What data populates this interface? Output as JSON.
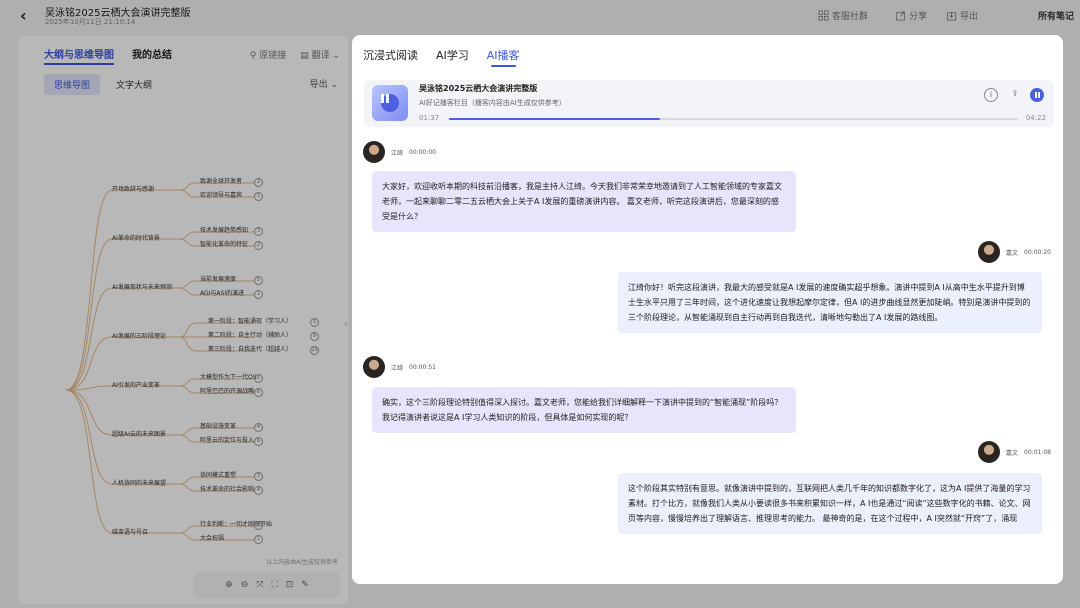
{
  "topbar": {
    "title": "吴泳铭2025云栖大会演讲完整版",
    "time": "2025年10月11日 21:10:14",
    "community": "客服社群",
    "share": "分享",
    "export": "导出",
    "all_notes": "所有笔记"
  },
  "left": {
    "tab_outline": "大纲与思维导图",
    "tab_summary": "我的总结",
    "source_link": "原链接",
    "translate": "翻译",
    "seg_mindmap": "思维导图",
    "seg_outline": "文字大纲",
    "export": "导出",
    "note": "以上内容由AI生成仅供参考",
    "mindmap": [
      {
        "label": "开场致辞与感谢",
        "children": [
          [
            "致谢全球开发者",
            "2"
          ],
          [
            "欢迎领导与嘉宾",
            "1"
          ]
        ]
      },
      {
        "label": "AI革命的时代背景",
        "children": [
          [
            "技术发展趋势感知",
            "3"
          ],
          [
            "智能化革命的特征",
            "2"
          ]
        ]
      },
      {
        "label": "AI发展现状与未来预测",
        "children": [
          [
            "当前发展速度",
            "5"
          ],
          [
            "AGI与ASI的演进",
            "1"
          ]
        ]
      },
      {
        "label": "AI发展的三阶段理论",
        "children": [
          [
            "第一阶段：智能涌现（学习人）",
            "5"
          ],
          [
            "第二阶段：自主行动（辅助人）",
            "9"
          ],
          [
            "第三阶段：自我迭代（超越人）",
            "10"
          ]
        ]
      },
      {
        "label": "AI引发的产业变革",
        "children": [
          [
            "大模型作为下一代OS",
            "5"
          ],
          [
            "阿里巴巴的开源战略",
            "6"
          ]
        ]
      },
      {
        "label": "超级AI云的未来图景",
        "children": [
          [
            "基础设施变革",
            "4"
          ],
          [
            "阿里云的定位与投入",
            "6"
          ]
        ]
      },
      {
        "label": "人机协同的未来展望",
        "children": [
          [
            "协同模式重塑",
            "3"
          ],
          [
            "技术革命的社会影响",
            "4"
          ]
        ]
      },
      {
        "label": "结束语与号召",
        "children": [
          [
            "行业判断：一切才刚刚开始",
            "3"
          ],
          [
            "大会祝福",
            "1"
          ]
        ]
      }
    ]
  },
  "modal": {
    "tabs": [
      "沉浸式阅读",
      "AI学习",
      "AI播客"
    ],
    "active_tab": 2,
    "player": {
      "title": "吴泳铭2025云栖大会演讲完整版",
      "subtitle": "AI好记播客栏目（播客内容由AI生成仅供参考）",
      "current": "01:37",
      "total": "04:22",
      "progress": 0.37
    },
    "messages": [
      {
        "speaker": "江绮",
        "time": "00:00:00",
        "side": "left",
        "text": "大家好，欢迎收听本期的科技前沿播客，我是主持人江绮。今天我们非常荣幸地邀请到了人工智能领域的专家嘉文老师，一起来聊聊二零二五云栖大会上关于A I发展的重磅演讲内容。 嘉文老师，听完这段演讲后，您最深刻的感受是什么？"
      },
      {
        "speaker": "嘉文",
        "time": "00:00:20",
        "side": "right",
        "text": "江绮你好！听完这段演讲，我最大的感受就是A I发展的速度确实超乎想象。演讲中提到A I从高中生水平提升到博士生水平只用了三年时间，这个进化速度让我想起摩尔定律，但A I的进步曲线显然更加陡峭。特别是演讲中提到的三个阶段理论，从智能涌现到自主行动再到自我迭代，清晰地勾勒出了A I发展的路线图。"
      },
      {
        "speaker": "江绮",
        "time": "00:00:51",
        "side": "left",
        "text": "确实，这个三阶段理论特别值得深入探讨。嘉文老师，您能给我们详细解释一下演讲中提到的“智能涌现”阶段吗？我记得演讲者说这是A I学习人类知识的阶段，但具体是如何实现的呢？"
      },
      {
        "speaker": "嘉文",
        "time": "00:01:08",
        "side": "right",
        "text": "这个阶段其实特别有意思。就像演讲中提到的，互联网把人类几千年的知识都数字化了，这为A I提供了海量的学习素材。打个比方，就像我们人类从小要读很多书来积累知识一样，A I也是通过“阅读”这些数字化的书籍、论文、网页等内容，慢慢培养出了理解语言、推理思考的能力。 最神奇的是，在这个过程中，A I突然就“开窍”了，涌现"
      }
    ]
  }
}
